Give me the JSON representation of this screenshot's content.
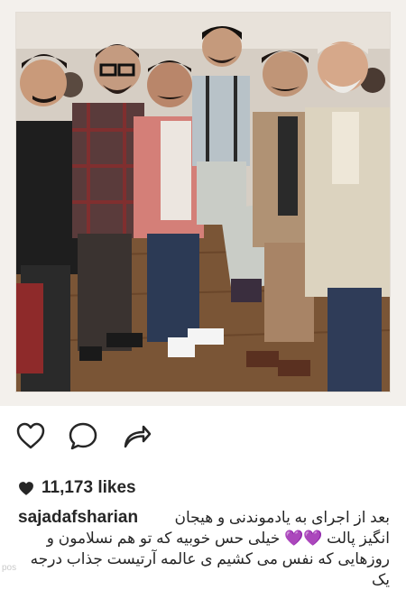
{
  "post": {
    "likes_icon": "heart-filled-icon",
    "likes_text": "11,173 likes",
    "username": "sajadafsharian",
    "caption_line1": "بعد از اجرای به یادموندنی و هیجان",
    "caption_line2": "انگیز پالت 💜💜 خیلی حس خوبیه که تو هم نسلامون و",
    "caption_line3": "روزهایی که نفس می کشیم ی عالمه آرتیست جذاب درجه یک"
  },
  "actions": {
    "like_icon": "heart-outline-icon",
    "comment_icon": "comment-bubble-icon",
    "share_icon": "share-arrow-icon"
  },
  "watermark": "pos",
  "colors": {
    "text": "#262626",
    "frame": "#f3f0ec",
    "heart_emoji": "#b27cdb"
  }
}
